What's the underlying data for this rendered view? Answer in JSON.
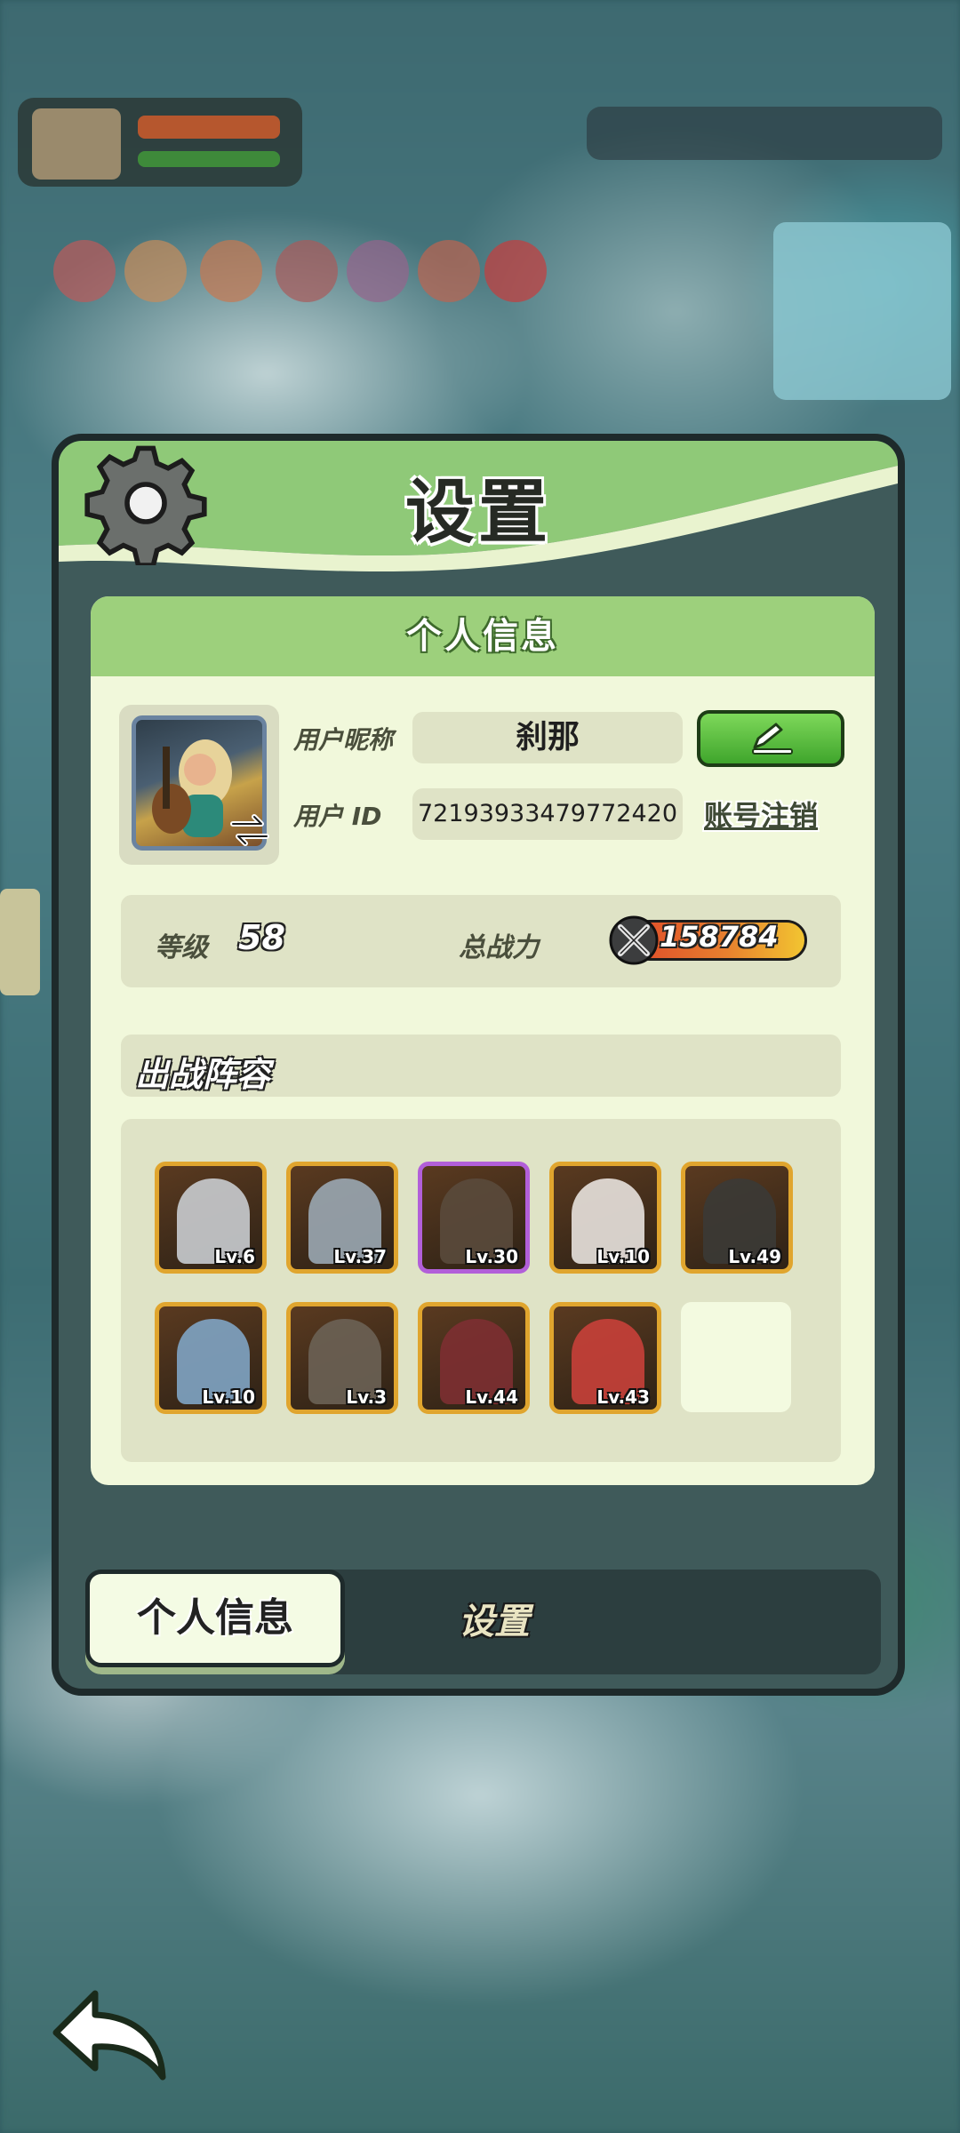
{
  "panel": {
    "title": "设置"
  },
  "section": {
    "header": "个人信息"
  },
  "profile": {
    "nickname_label": "用户昵称",
    "nickname": "刹那",
    "id_label": "用户  ID",
    "user_id": "7219393347977242​0",
    "cancel_account": "账号注销",
    "edit_icon": "pencil-icon",
    "swap_icon": "swap-arrows-icon"
  },
  "stats": {
    "level_label": "等级",
    "level": "58",
    "power_label": "总战力",
    "power": "158784",
    "power_icon": "crossed-swords-icon"
  },
  "lineup": {
    "title": "出战阵容",
    "heroes": [
      {
        "level": "Lv.6",
        "frame": "#e0a52e",
        "tone": "#c9ccd0"
      },
      {
        "level": "Lv.37",
        "frame": "#e0a52e",
        "tone": "#9aa7b3"
      },
      {
        "level": "Lv.30",
        "frame": "#b25fd9",
        "tone": "#5a4a3c"
      },
      {
        "level": "Lv.10",
        "frame": "#e0a52e",
        "tone": "#e8e2de"
      },
      {
        "level": "Lv.49",
        "frame": "#e0a52e",
        "tone": "#3b3a36"
      },
      {
        "level": "Lv.10",
        "frame": "#e0a52e",
        "tone": "#7fa4c4"
      },
      {
        "level": "Lv.3",
        "frame": "#e0a52e",
        "tone": "#6b6255"
      },
      {
        "level": "Lv.44",
        "frame": "#e0a52e",
        "tone": "#7d2f32"
      },
      {
        "level": "Lv.43",
        "frame": "#e0a52e",
        "tone": "#c8403a"
      }
    ]
  },
  "tabs": {
    "active": "个人信息",
    "other": "设置"
  },
  "nav": {
    "back_icon": "back-arrow-icon"
  }
}
